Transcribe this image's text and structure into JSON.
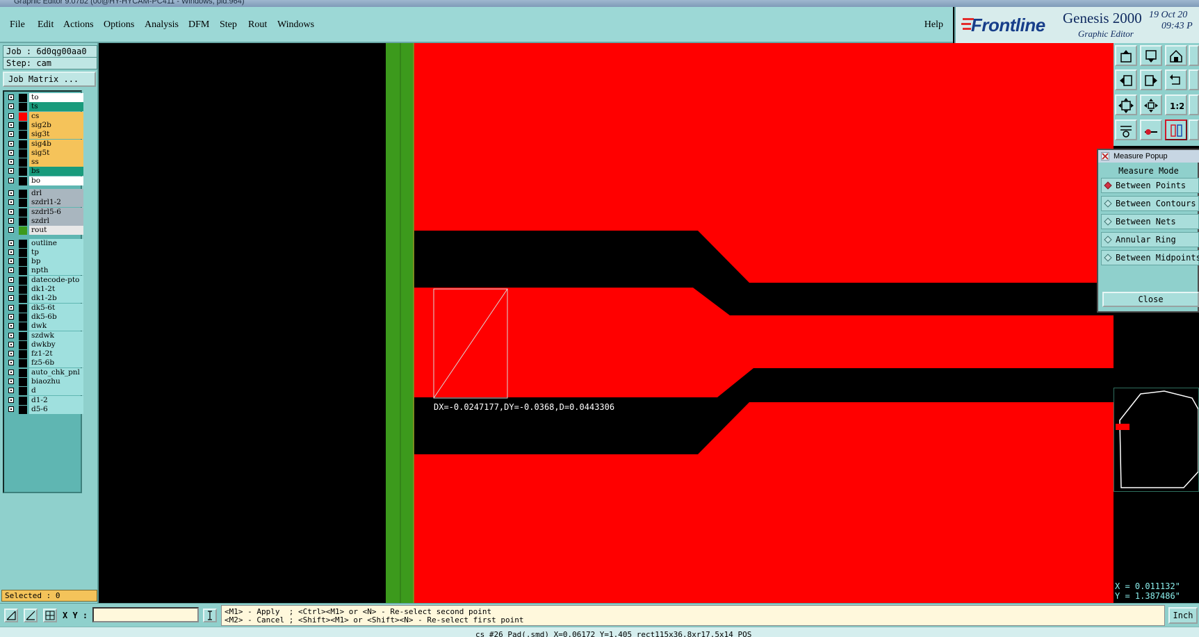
{
  "window": {
    "title": "Graphic Editor 9.07b2 (00@HY-HYCAM-PC411 - Windows, pid:964)"
  },
  "menu": {
    "items": [
      "File",
      "Edit",
      "Actions",
      "Options",
      "Analysis",
      "DFM",
      "Step",
      "Rout",
      "Windows"
    ],
    "help": "Help"
  },
  "brand": {
    "logo": "Frontline",
    "product": "Genesis 2000",
    "subproduct": "Graphic Editor",
    "date": "19 Oct 20",
    "time": "09:43 P"
  },
  "job": {
    "job": "Job  : 6d0qg00aa0",
    "step": "Step: cam",
    "matrix_button": "Job Matrix ..."
  },
  "layers": [
    {
      "name": "to",
      "bg": "#ffffff",
      "fg": "#000000",
      "mark": ""
    },
    {
      "name": "ts",
      "bg": "#199b7c",
      "fg": "#000000",
      "mark": ""
    },
    {
      "name": "cs",
      "bg": "#f5c35a",
      "fg": "#000000",
      "mark": "#ff0000"
    },
    {
      "name": "sig2b",
      "bg": "#f5c35a",
      "fg": "#000000",
      "mark": ""
    },
    {
      "name": "sig3t",
      "bg": "#f5c35a",
      "fg": "#000000",
      "mark": ""
    },
    {
      "name": "sig4b",
      "bg": "#f5c35a",
      "fg": "#000000",
      "mark": ""
    },
    {
      "name": "sig5t",
      "bg": "#f5c35a",
      "fg": "#000000",
      "mark": ""
    },
    {
      "name": "ss",
      "bg": "#f5c35a",
      "fg": "#000000",
      "mark": ""
    },
    {
      "name": "bs",
      "bg": "#199b7c",
      "fg": "#000000",
      "mark": ""
    },
    {
      "name": "bo",
      "bg": "#ffffff",
      "fg": "#000000",
      "mark": ""
    },
    {
      "name": "drl",
      "bg": "#a9b6bf",
      "fg": "#000000",
      "mark": ""
    },
    {
      "name": "szdrl1-2",
      "bg": "#a9b6bf",
      "fg": "#000000",
      "mark": ""
    },
    {
      "name": "szdrl5-6",
      "bg": "#a9b6bf",
      "fg": "#000000",
      "mark": ""
    },
    {
      "name": "szdrl",
      "bg": "#a9b6bf",
      "fg": "#000000",
      "mark": ""
    },
    {
      "name": "rout",
      "bg": "#e8e8e8",
      "fg": "#000000",
      "mark": "#3c9a1c"
    },
    {
      "name": "outline",
      "bg": "#9fe0de",
      "fg": "#000000",
      "mark": ""
    },
    {
      "name": "tp",
      "bg": "#9fe0de",
      "fg": "#000000",
      "mark": ""
    },
    {
      "name": "bp",
      "bg": "#9fe0de",
      "fg": "#000000",
      "mark": ""
    },
    {
      "name": "npth",
      "bg": "#9fe0de",
      "fg": "#000000",
      "mark": ""
    },
    {
      "name": "datecode-pto",
      "bg": "#9fe0de",
      "fg": "#000000",
      "mark": ""
    },
    {
      "name": "dk1-2t",
      "bg": "#9fe0de",
      "fg": "#000000",
      "mark": ""
    },
    {
      "name": "dk1-2b",
      "bg": "#9fe0de",
      "fg": "#000000",
      "mark": ""
    },
    {
      "name": "dk5-6t",
      "bg": "#9fe0de",
      "fg": "#000000",
      "mark": ""
    },
    {
      "name": "dk5-6b",
      "bg": "#9fe0de",
      "fg": "#000000",
      "mark": ""
    },
    {
      "name": "dwk",
      "bg": "#9fe0de",
      "fg": "#000000",
      "mark": ""
    },
    {
      "name": "szdwk",
      "bg": "#9fe0de",
      "fg": "#000000",
      "mark": ""
    },
    {
      "name": "dwkby",
      "bg": "#9fe0de",
      "fg": "#000000",
      "mark": ""
    },
    {
      "name": "fz1-2t",
      "bg": "#9fe0de",
      "fg": "#000000",
      "mark": ""
    },
    {
      "name": "fz5-6b",
      "bg": "#9fe0de",
      "fg": "#000000",
      "mark": ""
    },
    {
      "name": "auto_chk_pnl",
      "bg": "#9fe0de",
      "fg": "#000000",
      "mark": ""
    },
    {
      "name": "biaozhu",
      "bg": "#9fe0de",
      "fg": "#000000",
      "mark": ""
    },
    {
      "name": "d",
      "bg": "#9fe0de",
      "fg": "#000000",
      "mark": ""
    },
    {
      "name": "d1-2",
      "bg": "#9fe0de",
      "fg": "#000000",
      "mark": ""
    },
    {
      "name": "d5-6",
      "bg": "#9fe0de",
      "fg": "#000000",
      "mark": ""
    }
  ],
  "selected": "Selected : 0",
  "canvas": {
    "measure_text": "DX=-0.0247177,DY=-0.0368,D=0.0443306",
    "copper_color": "#ff0000",
    "rout_color": "#3c9a1c"
  },
  "measure_popup": {
    "title": "Measure Popup",
    "mode_title": "Measure Mode",
    "options": [
      "Between Points",
      "Between Contours",
      "Between Nets",
      "Annular Ring",
      "Between Midpoints"
    ],
    "selected": 0,
    "close": "Close"
  },
  "coords": {
    "x": "X = 0.011132\"",
    "y": "Y = 1.387486\""
  },
  "bottom": {
    "xy_label": "X Y :",
    "xy_value": "",
    "hint_line1": "<M1> - Apply  ; <Ctrl><M1> or <N> - Re-select second point",
    "hint_line2": "<M2> - Cancel ; <Shift><M1> or <Shift><N> - Re-select first point",
    "units": "Inch"
  },
  "status": "cs #26 Pad(.smd) X=0.06172 Y=1.405 rect115x36.8xr17.5x14 POS"
}
